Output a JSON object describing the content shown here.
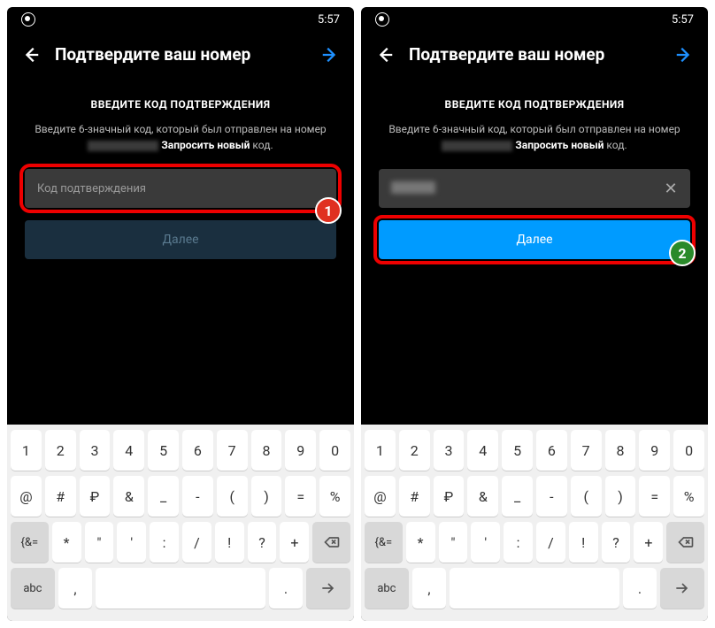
{
  "statusbar": {
    "time": "5:57"
  },
  "header": {
    "title": "Подтвердите ваш номер"
  },
  "content": {
    "heading": "ВВЕДИТЕ КОД ПОДТВЕРЖДЕНИЯ",
    "desc": "Введите 6-значный код, который был отправлен на номер",
    "link_text": "Запросить новый",
    "link_suffix": " код."
  },
  "input": {
    "placeholder": "Код подтверждения"
  },
  "buttons": {
    "next": "Далее"
  },
  "badges": {
    "one": "1",
    "two": "2"
  },
  "keyboard": {
    "row1": [
      "1",
      "2",
      "3",
      "4",
      "5",
      "6",
      "7",
      "8",
      "9",
      "0"
    ],
    "row2": [
      "@",
      "#",
      "₽",
      "&",
      "_",
      "-",
      "(",
      ")",
      "=",
      "%"
    ],
    "row3_lead": "{&=",
    "row3": [
      "*",
      "\"",
      "'",
      ":",
      "/",
      "!",
      "?",
      "+"
    ],
    "row4_abc": "abc",
    "row4_comma": ",",
    "row4_dot": "."
  }
}
